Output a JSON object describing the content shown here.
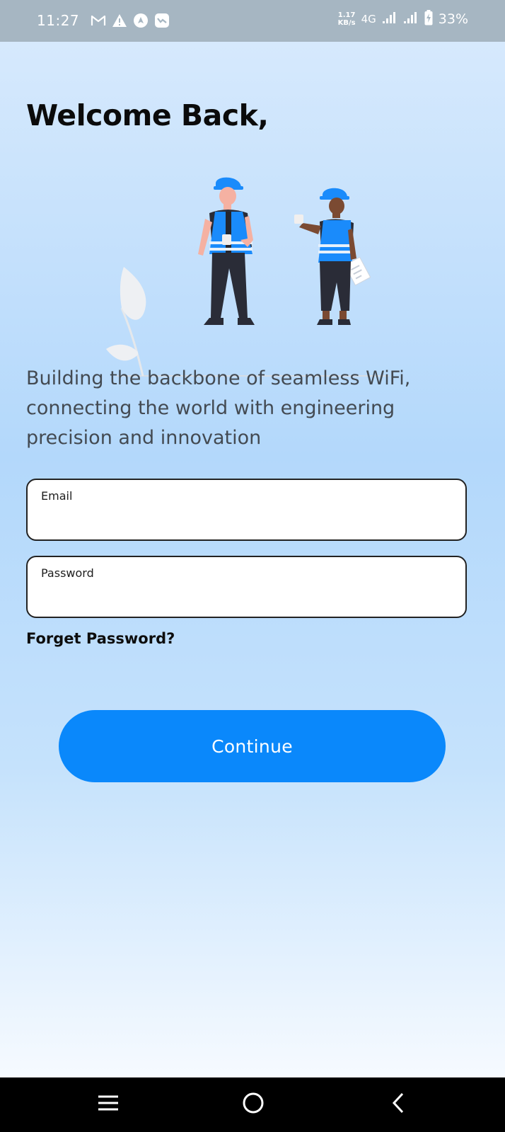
{
  "status_bar": {
    "time": "11:27",
    "net_speed_value": "1.17",
    "net_speed_unit": "KB/s",
    "network_type": "4G",
    "battery_percent": "33%",
    "icons": [
      "gmail-icon",
      "warning-icon",
      "navigation-icon",
      "chat-icon",
      "signal-icon",
      "signal-icon",
      "battery-charging-icon"
    ]
  },
  "login": {
    "title": "Welcome Back,",
    "tagline": "Building the backbone of seamless WiFi, connecting the world with engineering precision and innovation",
    "email_label": "Email",
    "email_value": "",
    "password_label": "Password",
    "password_value": "",
    "forgot_label": "Forget Password?",
    "continue_label": "Continue"
  },
  "nav_bar": {
    "icons": [
      "recent-apps-icon",
      "home-icon",
      "back-icon"
    ]
  },
  "colors": {
    "accent": "#0a88fb",
    "status_bar": "#a6b6c2",
    "helmet_vest": "#1a8bfb",
    "text_dark": "#0b0b0b",
    "tagline_text": "#434a52"
  }
}
